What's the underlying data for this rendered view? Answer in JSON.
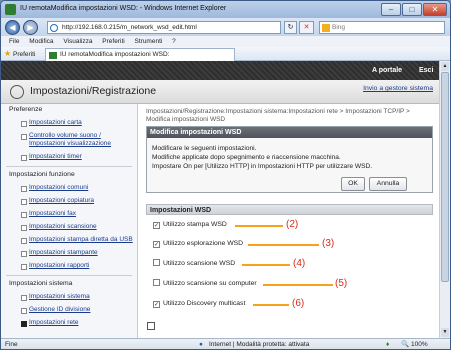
{
  "window": {
    "title": "IU remotaModifica impostazioni WSD: - Windows Internet Explorer",
    "min": "–",
    "max": "□",
    "close": "✕"
  },
  "address": {
    "url": "http://192.168.0.215/m_network_wsd_edit.html",
    "search_placeholder": "Bing"
  },
  "menu": [
    "File",
    "Modifica",
    "Visualizza",
    "Preferiti",
    "Strumenti",
    "?"
  ],
  "favorites": {
    "label": "Preferiti",
    "tab": "IU remotaModifica impostazioni WSD:"
  },
  "portal": {
    "link_portal": "A portale",
    "link_exit": "Esci"
  },
  "header": {
    "title": "Impostazioni/Registrazione",
    "mail_admin": "Invio a gestore sistema"
  },
  "sidebar": {
    "sec_pref": "Preferenze",
    "items_pref": [
      "Impostazioni carta",
      "Controllo volume suono / Impostazioni visualizzazione",
      "Impostazioni timer"
    ],
    "sec_func": "Impostazioni funzione",
    "items_func": [
      "Impostazioni comuni",
      "Impostazioni copiatura",
      "Impostazioni fax",
      "Impostazioni scansione",
      "Impostazioni stampa diretta da USB",
      "Impostazioni stampante",
      "Impostazioni rapporti"
    ],
    "sec_sys": "Impostazioni sistema",
    "items_sys": [
      "Impostazioni sistema",
      "Gestione ID divisione",
      "Impostazioni rete"
    ]
  },
  "breadcrumb": "Impostazioni/Registrazione:Impostazioni sistema:Impostazioni rete > Impostazioni TCP/IP > Modifica impostazioni WSD",
  "dialog": {
    "title": "Modifica impostazioni WSD",
    "line1": "Modificare le seguenti impostazioni.",
    "line2": "Modifiche applicate dopo spegnimento e riaccensione macchina.",
    "line3": "Impostare On per [Utilizzo HTTP] in Impostazioni HTTP per utilizzare WSD.",
    "ok": "OK",
    "cancel": "Annulla"
  },
  "wsd": {
    "section": "Impostazioni WSD",
    "options": [
      {
        "label": "Utilizzo stampa WSD",
        "checked": true,
        "callout": "(2)"
      },
      {
        "label": "Utilizzo esplorazione WSD",
        "checked": true,
        "callout": "(3)"
      },
      {
        "label": "Utilizzo scansione WSD",
        "checked": false,
        "callout": "(4)"
      },
      {
        "label": "Utilizzo scansione su computer",
        "checked": false,
        "callout": "(5)"
      },
      {
        "label": "Utilizzo Discovery multicast",
        "checked": true,
        "callout": "(6)"
      }
    ]
  },
  "status": {
    "left": "Fine",
    "zone": "Internet | Modalità protetta: attivata",
    "zoom": "100%"
  },
  "colors": {
    "callout": "#f6a21a",
    "callout_text": "#d72c1c",
    "link": "#1a3b8c"
  }
}
